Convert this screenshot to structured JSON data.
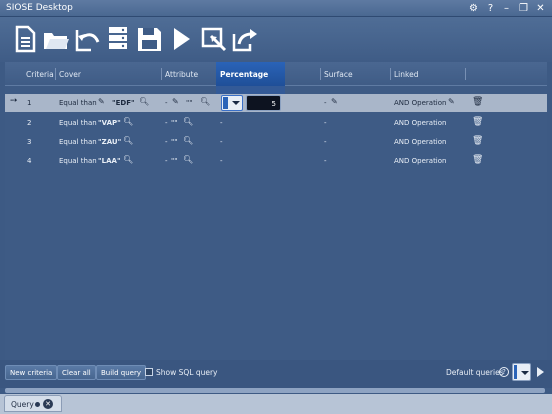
{
  "window": {
    "title": "SIOSE Desktop",
    "controls": [
      "gear-icon",
      "help-icon",
      "minimize-icon",
      "restore-icon",
      "close-icon"
    ]
  },
  "toolbar": {
    "buttons": [
      "new-document-icon",
      "open-folder-icon",
      "undo-icon",
      "database-icon",
      "save-icon",
      "run-icon",
      "clear-icon",
      "export-icon"
    ]
  },
  "table": {
    "columns": [
      "Criteria",
      "Cover",
      "Attribute",
      "Percentage",
      "Surface",
      "Linked"
    ],
    "active_column": "Percentage",
    "rows": [
      {
        "num": "1",
        "cover_op": "Equal than",
        "cover_val": "\"EDF\"",
        "attr_dash": "-",
        "attr_val": "\"\"",
        "pct_value": "5",
        "surface": "-",
        "linked": "AND Operation",
        "selected": true
      },
      {
        "num": "2",
        "cover_op": "Equal than",
        "cover_val": "\"VAP\"",
        "attr_dash": "-",
        "attr_val": "\"\"",
        "pct": "-",
        "surface": "-",
        "linked": "AND Operation"
      },
      {
        "num": "3",
        "cover_op": "Equal than",
        "cover_val": "\"ZAU\"",
        "attr_dash": "-",
        "attr_val": "\"\"",
        "pct": "-",
        "surface": "-",
        "linked": "AND Operation"
      },
      {
        "num": "4",
        "cover_op": "Equal than",
        "cover_val": "\"LAA\"",
        "attr_dash": "-",
        "attr_val": "\"\"",
        "pct": "-",
        "surface": "-",
        "linked": "AND Operation"
      }
    ]
  },
  "bottom": {
    "new_criteria": "New criteria",
    "clear_all": "Clear all",
    "build_query": "Build query",
    "show_sql": "Show SQL query",
    "default_queries": "Default queries",
    "help_mark": "?"
  },
  "tabs": [
    {
      "label": "Query"
    }
  ],
  "colors": {
    "background": "#3d5a84",
    "active_column": "#2a63b8",
    "selected_row": "#a9b6c9"
  }
}
